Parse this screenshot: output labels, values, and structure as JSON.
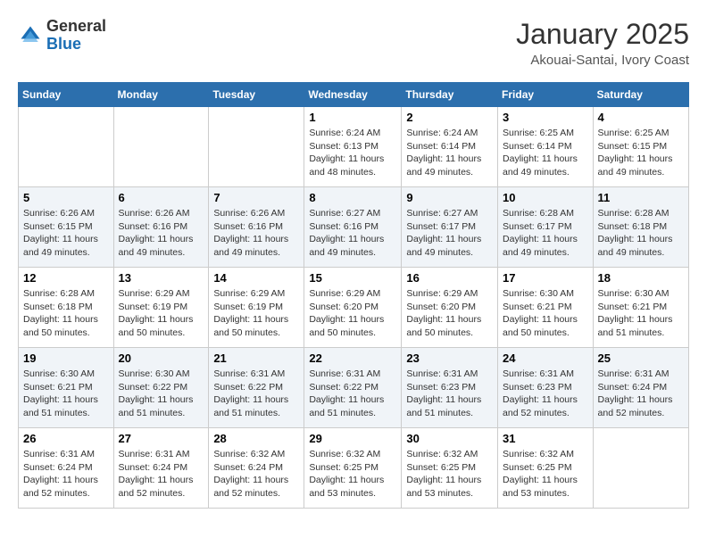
{
  "header": {
    "logo_general": "General",
    "logo_blue": "Blue",
    "month_year": "January 2025",
    "location": "Akouai-Santai, Ivory Coast"
  },
  "weekdays": [
    "Sunday",
    "Monday",
    "Tuesday",
    "Wednesday",
    "Thursday",
    "Friday",
    "Saturday"
  ],
  "weeks": [
    [
      {
        "day": "",
        "info": ""
      },
      {
        "day": "",
        "info": ""
      },
      {
        "day": "",
        "info": ""
      },
      {
        "day": "1",
        "info": "Sunrise: 6:24 AM\nSunset: 6:13 PM\nDaylight: 11 hours\nand 48 minutes."
      },
      {
        "day": "2",
        "info": "Sunrise: 6:24 AM\nSunset: 6:14 PM\nDaylight: 11 hours\nand 49 minutes."
      },
      {
        "day": "3",
        "info": "Sunrise: 6:25 AM\nSunset: 6:14 PM\nDaylight: 11 hours\nand 49 minutes."
      },
      {
        "day": "4",
        "info": "Sunrise: 6:25 AM\nSunset: 6:15 PM\nDaylight: 11 hours\nand 49 minutes."
      }
    ],
    [
      {
        "day": "5",
        "info": "Sunrise: 6:26 AM\nSunset: 6:15 PM\nDaylight: 11 hours\nand 49 minutes."
      },
      {
        "day": "6",
        "info": "Sunrise: 6:26 AM\nSunset: 6:16 PM\nDaylight: 11 hours\nand 49 minutes."
      },
      {
        "day": "7",
        "info": "Sunrise: 6:26 AM\nSunset: 6:16 PM\nDaylight: 11 hours\nand 49 minutes."
      },
      {
        "day": "8",
        "info": "Sunrise: 6:27 AM\nSunset: 6:16 PM\nDaylight: 11 hours\nand 49 minutes."
      },
      {
        "day": "9",
        "info": "Sunrise: 6:27 AM\nSunset: 6:17 PM\nDaylight: 11 hours\nand 49 minutes."
      },
      {
        "day": "10",
        "info": "Sunrise: 6:28 AM\nSunset: 6:17 PM\nDaylight: 11 hours\nand 49 minutes."
      },
      {
        "day": "11",
        "info": "Sunrise: 6:28 AM\nSunset: 6:18 PM\nDaylight: 11 hours\nand 49 minutes."
      }
    ],
    [
      {
        "day": "12",
        "info": "Sunrise: 6:28 AM\nSunset: 6:18 PM\nDaylight: 11 hours\nand 50 minutes."
      },
      {
        "day": "13",
        "info": "Sunrise: 6:29 AM\nSunset: 6:19 PM\nDaylight: 11 hours\nand 50 minutes."
      },
      {
        "day": "14",
        "info": "Sunrise: 6:29 AM\nSunset: 6:19 PM\nDaylight: 11 hours\nand 50 minutes."
      },
      {
        "day": "15",
        "info": "Sunrise: 6:29 AM\nSunset: 6:20 PM\nDaylight: 11 hours\nand 50 minutes."
      },
      {
        "day": "16",
        "info": "Sunrise: 6:29 AM\nSunset: 6:20 PM\nDaylight: 11 hours\nand 50 minutes."
      },
      {
        "day": "17",
        "info": "Sunrise: 6:30 AM\nSunset: 6:21 PM\nDaylight: 11 hours\nand 50 minutes."
      },
      {
        "day": "18",
        "info": "Sunrise: 6:30 AM\nSunset: 6:21 PM\nDaylight: 11 hours\nand 51 minutes."
      }
    ],
    [
      {
        "day": "19",
        "info": "Sunrise: 6:30 AM\nSunset: 6:21 PM\nDaylight: 11 hours\nand 51 minutes."
      },
      {
        "day": "20",
        "info": "Sunrise: 6:30 AM\nSunset: 6:22 PM\nDaylight: 11 hours\nand 51 minutes."
      },
      {
        "day": "21",
        "info": "Sunrise: 6:31 AM\nSunset: 6:22 PM\nDaylight: 11 hours\nand 51 minutes."
      },
      {
        "day": "22",
        "info": "Sunrise: 6:31 AM\nSunset: 6:22 PM\nDaylight: 11 hours\nand 51 minutes."
      },
      {
        "day": "23",
        "info": "Sunrise: 6:31 AM\nSunset: 6:23 PM\nDaylight: 11 hours\nand 51 minutes."
      },
      {
        "day": "24",
        "info": "Sunrise: 6:31 AM\nSunset: 6:23 PM\nDaylight: 11 hours\nand 52 minutes."
      },
      {
        "day": "25",
        "info": "Sunrise: 6:31 AM\nSunset: 6:24 PM\nDaylight: 11 hours\nand 52 minutes."
      }
    ],
    [
      {
        "day": "26",
        "info": "Sunrise: 6:31 AM\nSunset: 6:24 PM\nDaylight: 11 hours\nand 52 minutes."
      },
      {
        "day": "27",
        "info": "Sunrise: 6:31 AM\nSunset: 6:24 PM\nDaylight: 11 hours\nand 52 minutes."
      },
      {
        "day": "28",
        "info": "Sunrise: 6:32 AM\nSunset: 6:24 PM\nDaylight: 11 hours\nand 52 minutes."
      },
      {
        "day": "29",
        "info": "Sunrise: 6:32 AM\nSunset: 6:25 PM\nDaylight: 11 hours\nand 53 minutes."
      },
      {
        "day": "30",
        "info": "Sunrise: 6:32 AM\nSunset: 6:25 PM\nDaylight: 11 hours\nand 53 minutes."
      },
      {
        "day": "31",
        "info": "Sunrise: 6:32 AM\nSunset: 6:25 PM\nDaylight: 11 hours\nand 53 minutes."
      },
      {
        "day": "",
        "info": ""
      }
    ]
  ]
}
